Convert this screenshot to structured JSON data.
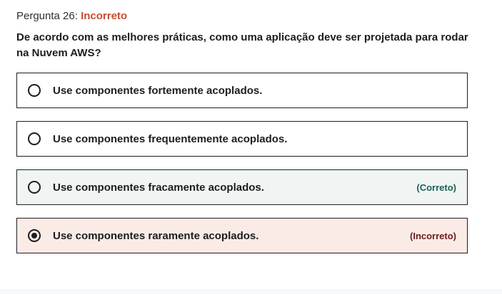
{
  "header": {
    "label": "Pergunta 26:",
    "status": "Incorreto"
  },
  "question": {
    "text": "De acordo com as melhores práticas, como uma aplicação deve ser projetada para rodar na Nuvem AWS?"
  },
  "options": [
    {
      "label": "Use componentes fortemente acoplados.",
      "selected": false,
      "feedback": ""
    },
    {
      "label": "Use componentes frequentemente acoplados.",
      "selected": false,
      "feedback": ""
    },
    {
      "label": "Use componentes fracamente acoplados.",
      "selected": false,
      "feedback": "(Correto)"
    },
    {
      "label": "Use componentes raramente acoplados.",
      "selected": true,
      "feedback": "(Incorreto)"
    }
  ],
  "colors": {
    "incorrect_status": "#c84d2f",
    "correct_bg": "#f0f5f3",
    "incorrect_bg": "#fbebe7",
    "correct_text": "#1e6055",
    "incorrect_text": "#6b1b1b"
  }
}
